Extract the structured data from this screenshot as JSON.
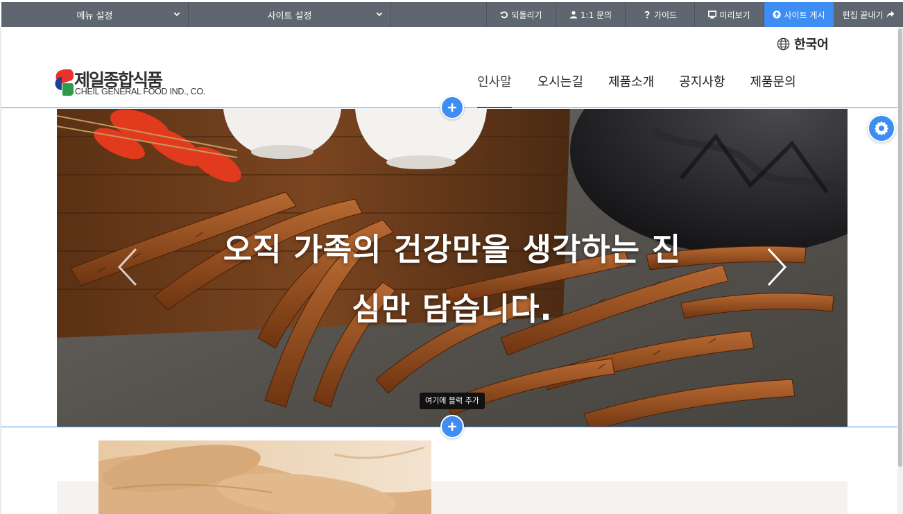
{
  "editor_bar": {
    "menu_settings": "메뉴 설정",
    "site_settings": "사이트 설정",
    "undo": "되돌리기",
    "inquiry": "1:1 문의",
    "guide": "가이드",
    "preview": "미리보기",
    "publish": "사이트 게시",
    "exit_edit": "편집 끝내기",
    "colors": {
      "bar": "#5f6670",
      "publish": "#3d8df2"
    }
  },
  "header": {
    "language": "한국어",
    "logo_kr": "제일종합식품",
    "logo_en": "CHEIL GENERAL FOOD IND., CO.",
    "nav": [
      "인사말",
      "오시는길",
      "제품소개",
      "공지사항",
      "제품문의"
    ],
    "active_nav_index": 0
  },
  "hero": {
    "caption_line1": "오직 가족의 건강만을 생각하는 진",
    "caption_line2": "심만 담습니다.",
    "prev_icon": "chevron-left-icon",
    "next_icon": "chevron-right-icon"
  },
  "editor": {
    "add_block_tooltip": "여기에 블럭 추가",
    "accent": "#3d8df2",
    "add_icon": "plus-icon",
    "settings_icon": "gear-icon"
  }
}
